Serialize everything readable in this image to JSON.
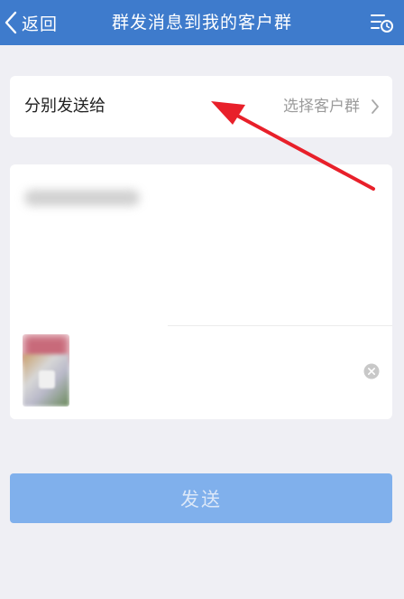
{
  "header": {
    "back_label": "返回",
    "title": "群发消息到我的客户群"
  },
  "recipient": {
    "label": "分别发送给",
    "choose_label": "选择客户群"
  },
  "send": {
    "label": "发送"
  },
  "colors": {
    "header_bg": "#3e7bcc",
    "page_bg": "#efeff4",
    "send_button_bg": "#80b0ec",
    "annotation_arrow": "#e8202a"
  },
  "icons": {
    "back": "chevron-left-icon",
    "menu": "list-clock-icon",
    "chevron": "chevron-right-icon",
    "remove": "close-circle-icon"
  }
}
